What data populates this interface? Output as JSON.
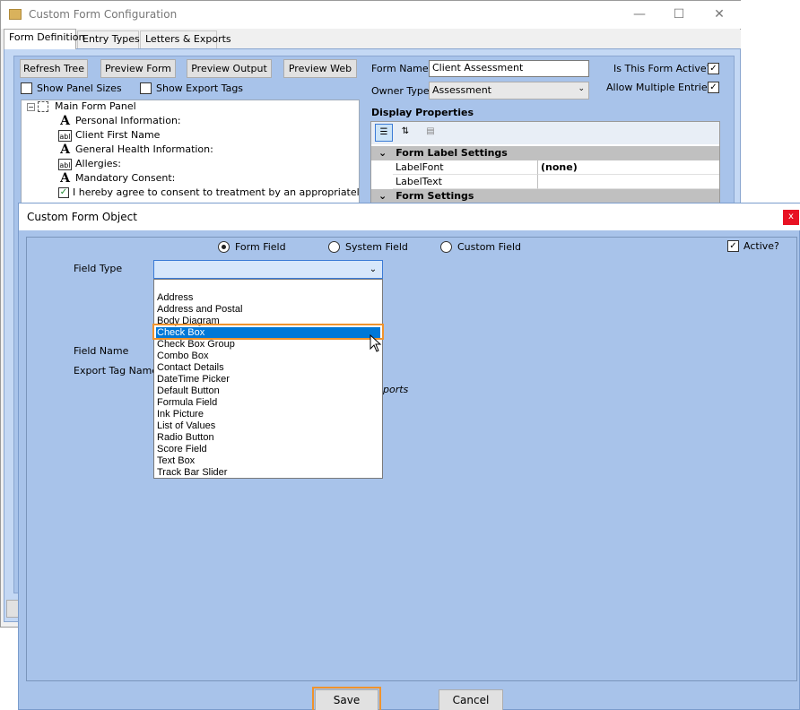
{
  "bg_window": {
    "title": "Custom Form Configuration",
    "tabs": [
      "Form Definition",
      "Entry Types",
      "Letters & Exports"
    ],
    "toolbar": {
      "refresh_tree": "Refresh Tree",
      "preview_form": "Preview Form",
      "preview_output": "Preview Output",
      "preview_web": "Preview Web"
    },
    "show_panel_sizes": "Show Panel Sizes",
    "show_export_tags": "Show Export Tags",
    "tree": {
      "root": "Main Form Panel",
      "items": [
        {
          "icon": "A",
          "label": "Personal Information:"
        },
        {
          "icon": "abl",
          "label": "Client First Name"
        },
        {
          "icon": "A",
          "label": "General Health Information:"
        },
        {
          "icon": "abl",
          "label": "Allergies:"
        },
        {
          "icon": "A",
          "label": "Mandatory Consent:"
        },
        {
          "icon": "check",
          "label": "I hereby agree to consent to treatment by an appropriately qualified"
        }
      ]
    },
    "form_name_label": "Form Name",
    "form_name_value": "Client Assessment",
    "owner_type_label": "Owner Type",
    "owner_type_value": "Assessment",
    "is_active_label": "Is This Form Active?",
    "allow_multiple_label": "Allow Multiple Entries?",
    "display_properties_label": "Display Properties",
    "property_grid": {
      "cat1": "Form Label Settings",
      "rows": [
        {
          "name": "LabelFont",
          "value": "(none)"
        },
        {
          "name": "LabelText",
          "value": ""
        }
      ],
      "cat2": "Form Settings"
    }
  },
  "dialog": {
    "title": "Custom Form Object",
    "close_glyph": "x",
    "radios": {
      "form_field": "Form Field",
      "system_field": "System Field",
      "custom_field": "Custom Field"
    },
    "active_label": "Active?",
    "field_type_label": "Field Type",
    "field_name_label": "Field Name",
    "export_tag_label": "Export Tag Name",
    "partial_text": "ports",
    "dropdown_items": [
      "Address",
      "Address and Postal",
      "Body Diagram",
      "Check Box",
      "Check Box Group",
      "Combo Box",
      "Contact Details",
      "DateTime Picker",
      "Default Button",
      "Formula Field",
      "Ink Picture",
      "List of Values",
      "Radio Button",
      "Score Field",
      "Text Box",
      "Track Bar Slider"
    ],
    "selected_item": "Check Box",
    "save_label": "Save",
    "cancel_label": "Cancel"
  },
  "colors": {
    "selection": "#0078d7",
    "highlight_outline": "#f0932c",
    "dialog_bg": "#a8c3ea"
  }
}
